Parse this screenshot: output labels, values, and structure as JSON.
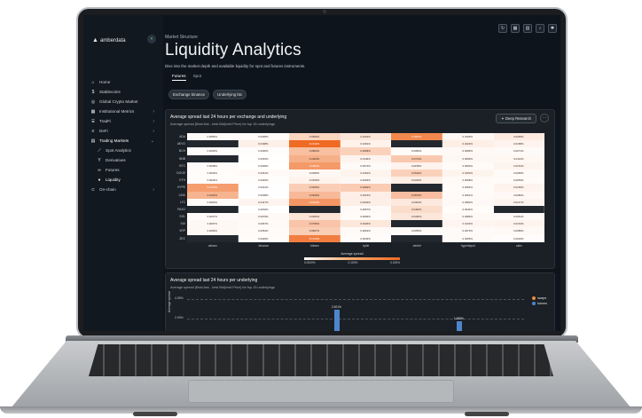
{
  "colors": {
    "accent": "#ef6a22",
    "bar_futures": "#4d86cc",
    "swaps": "#f08a3c",
    "background": "#0d141c"
  },
  "brand": "amberdata",
  "sidebar": {
    "items": [
      {
        "label": "Home",
        "icon": "home-icon"
      },
      {
        "label": "Stablecoins",
        "icon": "dollar-icon"
      },
      {
        "label": "Global Crypto Market",
        "icon": "globe-icon"
      },
      {
        "label": "Institutional Metrics",
        "icon": "building-icon"
      },
      {
        "label": "TradFi",
        "icon": "bank-icon"
      },
      {
        "label": "DeFi",
        "icon": "layers-icon"
      },
      {
        "label": "Trading Markets",
        "icon": "chart-icon"
      },
      {
        "label": "Spot Analytics",
        "icon": "trend-icon"
      },
      {
        "label": "Derivatives",
        "icon": "fork-icon"
      },
      {
        "label": "Futures",
        "icon": "infinity-icon"
      },
      {
        "label": "Liquidity",
        "icon": "drop-icon"
      },
      {
        "label": "On-chain",
        "icon": "chain-icon"
      }
    ]
  },
  "header": {
    "breadcrumb": "Market Structure",
    "title": "Liquidity Analytics",
    "description": "Dive into the market depth and available liquidity for spot and futures instruments."
  },
  "tabs": [
    {
      "label": "Futures"
    },
    {
      "label": "Spot"
    }
  ],
  "chips": [
    {
      "label": "Exchange binance"
    },
    {
      "label": "Underlying btc"
    }
  ],
  "card1": {
    "title": "Average spread last 24 hours per exchange and underlying",
    "subtitle": "Average spread (Best Ask - best Bid)/mid Price) for top 15 underlyings",
    "deep_research": "Deep Research",
    "legend_title": "Average spread",
    "legend_ticks": [
      "0.0000%",
      "0.100%",
      "0.200%"
    ]
  },
  "card2": {
    "title": "Average spread last 24 hours per underlying",
    "subtitle": "Average spread (Best Ask - best Bid)/mid Price) for top 15 underlyings",
    "ylabel": "Average spread",
    "yticks": [
      "4.00%",
      "2.00%"
    ],
    "legend": [
      {
        "label": "swaps"
      },
      {
        "label": "futures"
      }
    ]
  },
  "chart_data": [
    {
      "type": "heatmap",
      "title": "Average spread last 24 hours per exchange and underlying",
      "x": [
        "okharn",
        "binance",
        "bitmex",
        "bybit",
        "deribit",
        "hyperliquid",
        "okex"
      ],
      "y": [
        "ADA",
        "AEVO",
        "BCH",
        "BNB",
        "BTC",
        "DOGE",
        "ETH",
        "HYPE",
        "LINK",
        "LTC",
        "PAXG",
        "SOL",
        "SUI",
        "XRP",
        "ZEC"
      ],
      "values": [
        [
          "0.0056%",
          "0.0035%",
          "0.0566%",
          "0.0332%",
          "0.1601%",
          "0.0106%",
          "0.0265%"
        ],
        [
          null,
          "0.0198%",
          "0.2142%",
          "0.0181%",
          null,
          "0.0223%",
          "0.0158%"
        ],
        [
          "0.0030%",
          "0.0030%",
          "0.0863%",
          "0.0608%",
          "0.0060%",
          "0.0086%",
          "0.0071%"
        ],
        [
          null,
          "0.0016%",
          "0.1064%",
          "0.0146%",
          "0.0724%",
          "0.0096%",
          "0.0114%"
        ],
        [
          "0.0048%",
          "0.0006%",
          "0.1364%",
          "0.0072%",
          "0.0155%",
          "0.0053%",
          "0.0151%"
        ],
        [
          "0.0042%",
          "0.0061%",
          "0.0096%",
          "0.0152%",
          "0.0626%",
          "0.0152%",
          "0.0065%"
        ],
        [
          "0.0044%",
          "0.0032%",
          "0.0165%",
          "0.0093%",
          "0.0222%",
          "0.0068%",
          "0.0053%"
        ],
        [
          "0.1310%",
          "0.0012%",
          "0.0665%",
          "0.0682%",
          null,
          "0.0054%",
          "0.0165%"
        ],
        [
          "0.1002%",
          "0.0008%",
          "0.0940%",
          "0.0215%",
          "0.0870%",
          "0.0061%",
          "0.0082%"
        ],
        [
          "0.0060%",
          "0.0147%",
          "0.1403%",
          "0.0226%",
          "0.0304%",
          "0.0082%",
          "0.0147%"
        ],
        [
          null,
          "0.0002%",
          null,
          "0.0067%",
          "0.0462%",
          "0.0044%",
          null
        ],
        [
          "0.0047%",
          "0.0079%",
          "0.0362%",
          "0.0056%",
          "0.0332%",
          "0.0086%",
          "0.0061%"
        ],
        [
          "0.0097%",
          "0.0067%",
          "0.0796%",
          "0.0326%",
          null,
          "0.0133%",
          "0.0164%"
        ],
        [
          "0.0096%",
          "0.0054%",
          "0.0667%",
          "0.0064%",
          "0.0055%",
          "0.0073%",
          "0.0086%"
        ],
        [
          null,
          "0.0029%",
          "0.1726%",
          "0.0039%",
          null,
          "0.0065%",
          "0.0034%"
        ]
      ],
      "color_scale": [
        0,
        0.2
      ],
      "legend": "Average spread"
    },
    {
      "type": "bar",
      "title": "Average spread last 24 hours per underlying",
      "ylabel": "Average spread",
      "ylim": [
        0,
        4
      ],
      "series": [
        {
          "name": "futures",
          "points": [
            {
              "label": "2.921%",
              "value": 2.921
            },
            {
              "label": "1.685%",
              "value": 1.685
            }
          ]
        }
      ]
    }
  ]
}
